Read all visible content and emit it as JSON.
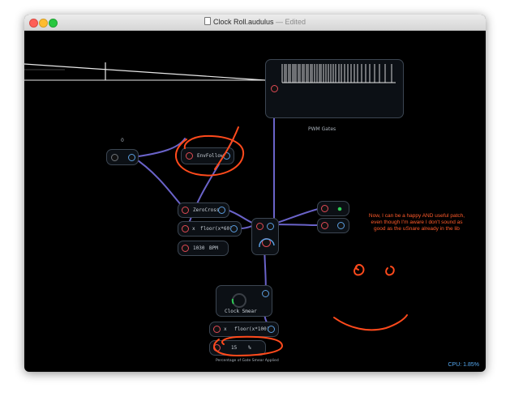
{
  "window": {
    "title": "Clock Roll.audulus",
    "edited_suffix": " — Edited"
  },
  "nodes": {
    "knob_value": "0",
    "envfollow_label": "EnvFollow",
    "zerocross_label": "ZeroCross",
    "floor_x60_op": "x",
    "floor_x60_label": "floor(x*60)",
    "bpm_value": "1030",
    "bpm_unit": "BPM",
    "pwm_caption": "PWM Gates",
    "clock_smear_label": "Clock Smear",
    "floor_x100_op": "x",
    "floor_x100_label": "floor(x*100)",
    "percent_value": "15",
    "percent_unit": "%",
    "percent_caption": "Percentage of Gate Smear Applied"
  },
  "annotation": {
    "line1": "Now, I can be a happy AND useful patch,",
    "line2": "even though I'm aware I don't sound as",
    "line3": "good as the uSnare already in the lib"
  },
  "status": {
    "cpu": "CPU: 1.85%"
  },
  "colors": {
    "wire": "#6a63c9",
    "annotation": "#ff4a1c",
    "port_red": "#e04a55",
    "port_blue": "#5a9ddf",
    "cpu_text": "#55a8f0"
  }
}
